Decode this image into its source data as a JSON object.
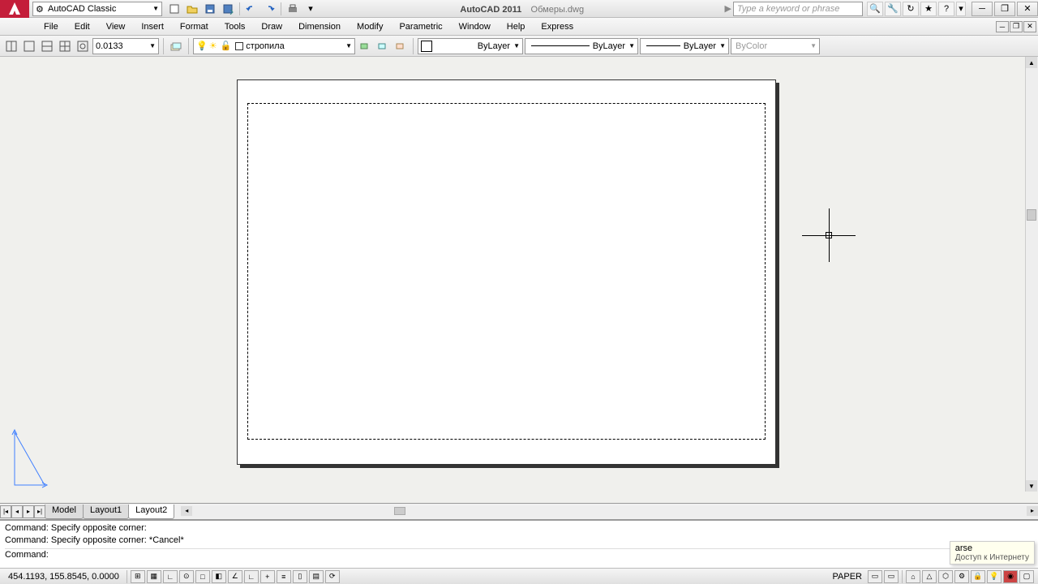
{
  "workspace": "AutoCAD Classic",
  "title": {
    "app": "AutoCAD 2011",
    "doc": "Обмеры.dwg"
  },
  "search_placeholder": "Type a keyword or phrase",
  "menus": [
    "File",
    "Edit",
    "View",
    "Insert",
    "Format",
    "Tools",
    "Draw",
    "Dimension",
    "Modify",
    "Parametric",
    "Window",
    "Help",
    "Express"
  ],
  "linewidth_value": "0.0133",
  "layer_name": "стропила",
  "props": {
    "color": "ByLayer",
    "linetype": "ByLayer",
    "lineweight": "ByLayer",
    "plotstyle": "ByColor"
  },
  "tabs": {
    "items": [
      "Model",
      "Layout1",
      "Layout2"
    ],
    "active": 2
  },
  "command_history": [
    "Command: Specify opposite corner:",
    "Command: Specify opposite corner: *Cancel*"
  ],
  "command_prompt": "Command:",
  "tooltip": {
    "title": "arse",
    "subtitle": "Доступ к Интернету"
  },
  "status": {
    "coords": "454.1193, 155.8545, 0.0000",
    "space": "PAPER"
  }
}
